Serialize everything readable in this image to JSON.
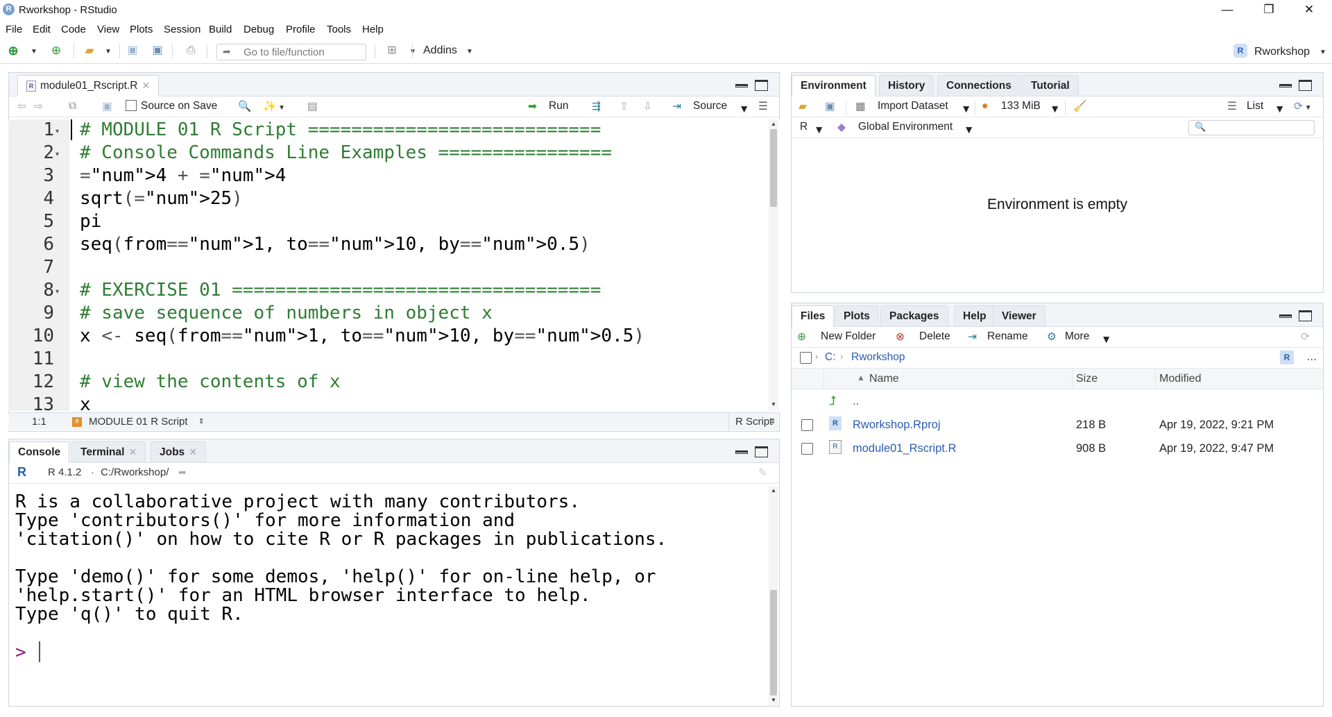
{
  "window": {
    "title": "Rworkshop - RStudio",
    "app_icon_letter": "R",
    "minimize_glyph": "—",
    "restore_glyph": "❐",
    "close_glyph": "✕"
  },
  "menu": [
    "File",
    "Edit",
    "Code",
    "View",
    "Plots",
    "Session",
    "Build",
    "Debug",
    "Profile",
    "Tools",
    "Help"
  ],
  "toolbar": {
    "goto_placeholder": "Go to file/function",
    "addins_label": "Addins",
    "project_label": "Rworkshop"
  },
  "editor": {
    "tab_label": "module01_Rscript.R",
    "source_on_save_label": "Source on Save",
    "run_label": "Run",
    "source_label": "Source",
    "line_numbers": [
      "1",
      "2",
      "3",
      "4",
      "5",
      "6",
      "7",
      "8",
      "9",
      "10",
      "11",
      "12",
      "13"
    ],
    "lines": [
      "# MODULE 01 R Script ===========================",
      "# Console Commands Line Examples ================",
      "4 + 4",
      "sqrt(25)",
      "pi",
      "seq(from=1, to=10, by=0.5)",
      "",
      "# EXERCISE 01 ==================================",
      "# save sequence of numbers in object x",
      "x <- seq(from=1, to=10, by=0.5)",
      "",
      "# view the contents of x",
      "x"
    ],
    "status_position": "1:1",
    "status_section": "MODULE 01 R Script",
    "status_filetype": "R Script"
  },
  "console": {
    "tabs": [
      "Console",
      "Terminal",
      "Jobs"
    ],
    "r_version": "R 4.1.2",
    "separator": "·",
    "path": "C:/Rworkshop/",
    "lines": [
      "R is a collaborative project with many contributors.",
      "Type 'contributors()' for more information and",
      "'citation()' on how to cite R or R packages in publications.",
      "",
      "Type 'demo()' for some demos, 'help()' for on-line help, or",
      "'help.start()' for an HTML browser interface to help.",
      "Type 'q()' to quit R."
    ],
    "prompt": ">"
  },
  "environment": {
    "tabs": [
      "Environment",
      "History",
      "Connections",
      "Tutorial"
    ],
    "import_dataset_label": "Import Dataset",
    "memory_label": "133 MiB",
    "list_label": "List",
    "language_label": "R",
    "scope_label": "Global Environment",
    "empty_message": "Environment is empty"
  },
  "files": {
    "tabs": [
      "Files",
      "Plots",
      "Packages",
      "Help",
      "Viewer"
    ],
    "new_folder_label": "New Folder",
    "delete_label": "Delete",
    "rename_label": "Rename",
    "more_label": "More",
    "breadcrumb_root": "C:",
    "breadcrumb_folder": "Rworkshop",
    "columns": {
      "name": "Name",
      "size": "Size",
      "modified": "Modified"
    },
    "parent_label": "..",
    "rows": [
      {
        "name": "Rworkshop.Rproj",
        "size": "218 B",
        "modified": "Apr 19, 2022, 9:21 PM"
      },
      {
        "name": "module01_Rscript.R",
        "size": "908 B",
        "modified": "Apr 19, 2022, 9:47 PM"
      }
    ]
  },
  "colors": {
    "accent_blue": "#2a5db0",
    "comment_green": "#2e7d32",
    "number_blue": "#1a1aa6",
    "prompt_purple": "#8a1a8a"
  }
}
